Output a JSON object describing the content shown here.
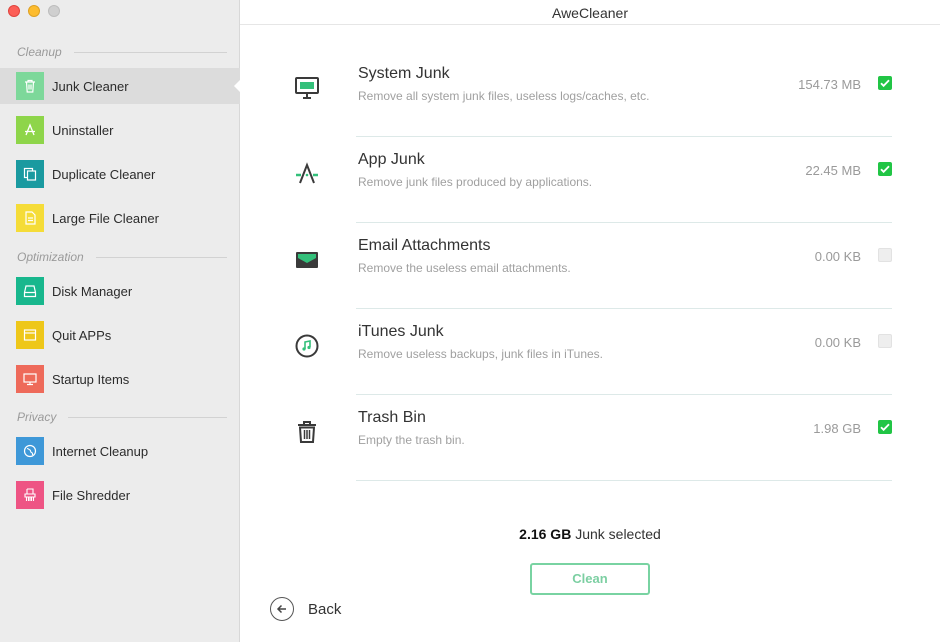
{
  "window": {
    "title": "AweCleaner"
  },
  "sidebar": {
    "sections": [
      {
        "label": "Cleanup"
      },
      {
        "label": "Optimization"
      },
      {
        "label": "Privacy"
      }
    ],
    "items": [
      {
        "label": "Junk Cleaner",
        "icon": "trash-icon",
        "color": "#7dd89a",
        "active": true
      },
      {
        "label": "Uninstaller",
        "icon": "app-store-icon",
        "color": "#8ed54a"
      },
      {
        "label": "Duplicate Cleaner",
        "icon": "duplicate-icon",
        "color": "#1a9aa0"
      },
      {
        "label": "Large File Cleaner",
        "icon": "document-icon",
        "color": "#f5dc38"
      },
      {
        "label": "Disk Manager",
        "icon": "disk-icon",
        "color": "#18b78d"
      },
      {
        "label": "Quit APPs",
        "icon": "window-icon",
        "color": "#eec71a"
      },
      {
        "label": "Startup Items",
        "icon": "monitor-icon",
        "color": "#ee6a5a"
      },
      {
        "label": "Internet Cleanup",
        "icon": "globe-icon",
        "color": "#3e98d8"
      },
      {
        "label": "File Shredder",
        "icon": "shredder-icon",
        "color": "#ee5484"
      }
    ]
  },
  "junk_items": [
    {
      "title": "System Junk",
      "description": "Remove all system junk files, useless logs/caches, etc.",
      "size": "154.73 MB",
      "checked": true,
      "icon": "monitor-icon"
    },
    {
      "title": "App Junk",
      "description": "Remove junk files produced by applications.",
      "size": "22.45 MB",
      "checked": true,
      "icon": "app-store-icon"
    },
    {
      "title": "Email Attachments",
      "description": "Remove the useless email attachments.",
      "size": "0.00 KB",
      "checked": false,
      "icon": "envelope-icon"
    },
    {
      "title": "iTunes Junk",
      "description": "Remove useless backups, junk files in iTunes.",
      "size": "0.00 KB",
      "checked": false,
      "icon": "music-note-icon"
    },
    {
      "title": "Trash Bin",
      "description": "Empty the trash bin.",
      "size": "1.98 GB",
      "checked": true,
      "icon": "trash-icon"
    }
  ],
  "summary": {
    "amount": "2.16 GB",
    "label": " Junk selected"
  },
  "actions": {
    "clean_label": "Clean",
    "back_label": "Back"
  },
  "colors": {
    "check_on": "#21c545",
    "accent_green": "#79d3a2"
  }
}
